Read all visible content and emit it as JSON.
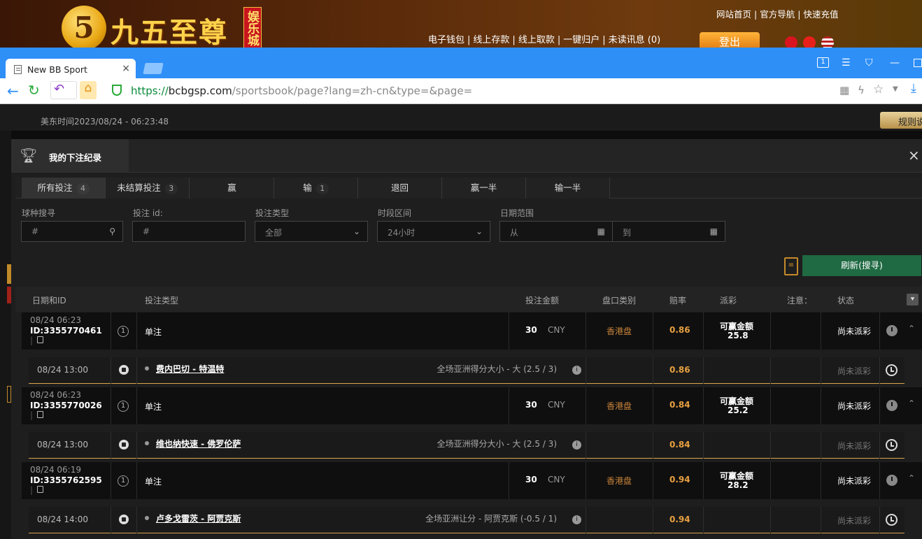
{
  "banner": {
    "logo_digit": "5",
    "logo_text": "九五至尊",
    "logo_badge": "娱乐城",
    "top_links": [
      "网站首页",
      "官方导航",
      "快速充值"
    ],
    "nav_links": [
      "电子钱包",
      "线上存款",
      "线上取款",
      "一键归户",
      "未读讯息 (0)"
    ],
    "logout": "登出"
  },
  "browser": {
    "tab_title": "New BB Sport",
    "tab_close": "×",
    "url_scheme": "https://",
    "url_host": "bcbgsp.com",
    "url_path": "/sportsbook/page?lang=zh-cn&type=&page="
  },
  "page": {
    "time": "美东时间2023/08/24 - 06:23:48",
    "rules_btn": "规则说"
  },
  "modal": {
    "title": "我的下注纪录",
    "close": "×",
    "tabs": [
      {
        "label": "所有投注",
        "count": "4"
      },
      {
        "label": "未结算投注",
        "count": "3"
      },
      {
        "label": "赢",
        "count": ""
      },
      {
        "label": "输",
        "count": "1"
      },
      {
        "label": "退回",
        "count": ""
      },
      {
        "label": "赢一半",
        "count": ""
      },
      {
        "label": "输一半",
        "count": ""
      }
    ],
    "filters": {
      "sport_label": "球种搜寻",
      "sport_placeholder": "#",
      "betid_label": "投注 id:",
      "betid_placeholder": "#",
      "type_label": "投注类型",
      "type_value": "全部",
      "period_label": "时段区间",
      "period_value": "24小时",
      "date_label": "日期范围",
      "date_from": "从",
      "date_to": "到"
    },
    "refresh": "刷新(搜寻)",
    "columns": {
      "date_id": "日期和ID",
      "bet_type": "投注类型",
      "amount": "投注金额",
      "market": "盘口类别",
      "odds": "赔率",
      "payout": "派彩",
      "note": "注意：",
      "status": "状态"
    },
    "bets": [
      {
        "date": "08/24 06:23",
        "id": "ID:3355770461",
        "idx": "1",
        "type": "单注",
        "amount": "30",
        "currency": "CNY",
        "market": "香港盘",
        "odds": "0.86",
        "payout_label": "可赢金额",
        "payout_value": "25.8",
        "status": "尚未派彩",
        "sub": {
          "time": "08/24 13:00",
          "match": "费内巴切 - 特温特",
          "market": "全场亚洲得分大小 - 大 (2.5 / 3)",
          "odds": "0.86",
          "status": "尚未派彩"
        }
      },
      {
        "date": "08/24 06:23",
        "id": "ID:3355770026",
        "idx": "1",
        "type": "单注",
        "amount": "30",
        "currency": "CNY",
        "market": "香港盘",
        "odds": "0.84",
        "payout_label": "可赢金额",
        "payout_value": "25.2",
        "status": "尚未派彩",
        "sub": {
          "time": "08/24 13:00",
          "match": "维也纳快速 - 佛罗伦萨",
          "market": "全场亚洲得分大小 - 大 (2.5 / 3)",
          "odds": "0.84",
          "status": "尚未派彩"
        }
      },
      {
        "date": "08/24 06:19",
        "id": "ID:3355762595",
        "idx": "1",
        "type": "单注",
        "amount": "30",
        "currency": "CNY",
        "market": "香港盘",
        "odds": "0.94",
        "payout_label": "可赢金额",
        "payout_value": "28.2",
        "status": "尚未派彩",
        "sub": {
          "time": "08/24 14:00",
          "match": "卢多戈雷茨 - 阿贾克斯",
          "market": "全场亚洲让分 - 阿贾克斯 (-0.5 / 1)",
          "odds": "0.94",
          "status": "尚未派彩"
        }
      }
    ]
  },
  "colors": {
    "accent_green": "#1f6a43",
    "odds_orange": "#e8a040",
    "browser_blue": "#2e8ff7"
  }
}
